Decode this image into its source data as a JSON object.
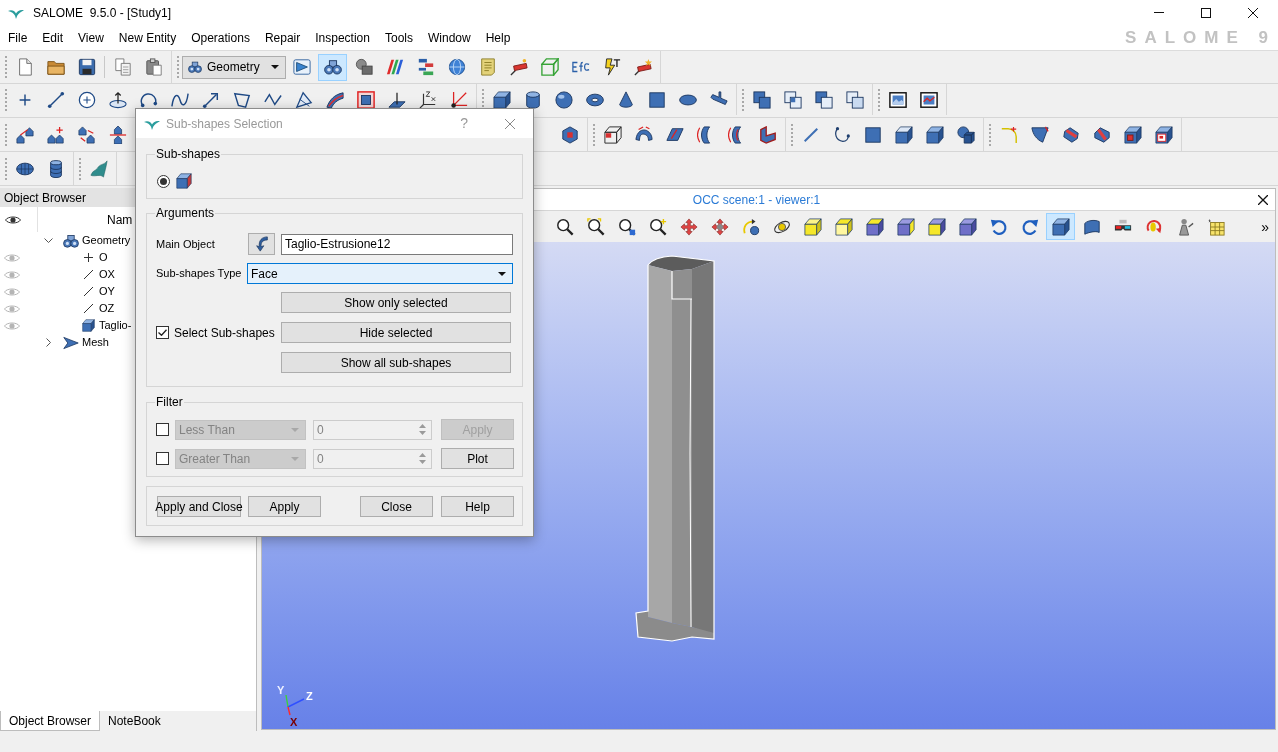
{
  "window": {
    "title": "SALOME  9.5.0 - [Study1]",
    "logo": "SALOME 9"
  },
  "menu": [
    "File",
    "Edit",
    "View",
    "New Entity",
    "Operations",
    "Repair",
    "Inspection",
    "Tools",
    "Window",
    "Help"
  ],
  "toolbar": {
    "module_combo": "Geometry",
    "module_buttons": [
      {
        "selected": false
      },
      {
        "selected": true
      },
      {
        "selected": false
      },
      {
        "selected": false
      },
      {
        "selected": false
      },
      {
        "selected": false
      },
      {
        "selected": false
      },
      {
        "selected": false
      },
      {
        "selected": false
      },
      {
        "selected": false
      },
      {
        "selected": false
      },
      {
        "selected": false
      }
    ]
  },
  "object_browser": {
    "title": "Object Browser",
    "column": "Nam",
    "tree": [
      {
        "label": "Geometry",
        "kind": "geometry",
        "expanded": true,
        "children": [
          {
            "label": "O",
            "kind": "point"
          },
          {
            "label": "OX",
            "kind": "vector"
          },
          {
            "label": "OY",
            "kind": "vector"
          },
          {
            "label": "OZ",
            "kind": "vector"
          },
          {
            "label": "Taglio-",
            "kind": "solid"
          }
        ]
      },
      {
        "label": "Mesh",
        "kind": "mesh",
        "expanded": false
      }
    ],
    "tabs": [
      {
        "label": "Object Browser",
        "selected": true
      },
      {
        "label": "NoteBook",
        "selected": false
      }
    ]
  },
  "viewer": {
    "title": "OCC scene:1 - viewer:1",
    "buttons": [
      {
        "selected": false
      },
      {
        "selected": false
      },
      {
        "selected": false
      },
      {
        "selected": false
      },
      {
        "selected": false
      },
      {
        "selected": false
      },
      {
        "selected": false
      },
      {
        "selected": false
      },
      {
        "selected": false
      },
      {
        "selected": false
      },
      {
        "selected": false
      },
      {
        "selected": false
      },
      {
        "selected": false
      },
      {
        "selected": false
      },
      {
        "selected": false
      },
      {
        "selected": false
      },
      {
        "selected": true
      },
      {
        "selected": false
      },
      {
        "selected": false
      },
      {
        "selected": false
      },
      {
        "selected": false
      },
      {
        "selected": false
      }
    ],
    "more": "»",
    "axes": [
      "Y",
      "Z",
      "X"
    ]
  },
  "dialog": {
    "title": "Sub-shapes Selection",
    "help": "?",
    "subshapes": {
      "title": "Sub-shapes",
      "options": [
        {
          "selected": true
        }
      ]
    },
    "arguments": {
      "title": "Arguments",
      "main_object": {
        "label": "Main Object",
        "value": "Taglio-Estrusione12"
      },
      "type": {
        "label": "Sub-shapes Type",
        "value": "Face"
      },
      "select_subshapes": {
        "label": "Select Sub-shapes",
        "checked": true
      },
      "buttons": [
        "Show only selected",
        "Hide selected",
        "Show all sub-shapes"
      ]
    },
    "filter": {
      "title": "Filter",
      "rows": [
        {
          "checked": false,
          "criterion": "Less Than",
          "value": "0",
          "disabled": true,
          "button": {
            "label": "Apply",
            "disabled": true
          }
        },
        {
          "checked": false,
          "criterion": "Greater Than",
          "value": "0",
          "disabled": true,
          "button": {
            "label": "Plot",
            "disabled": false
          }
        }
      ]
    },
    "buttons": [
      "Apply and Close",
      "Apply",
      "Close",
      "Help"
    ]
  }
}
